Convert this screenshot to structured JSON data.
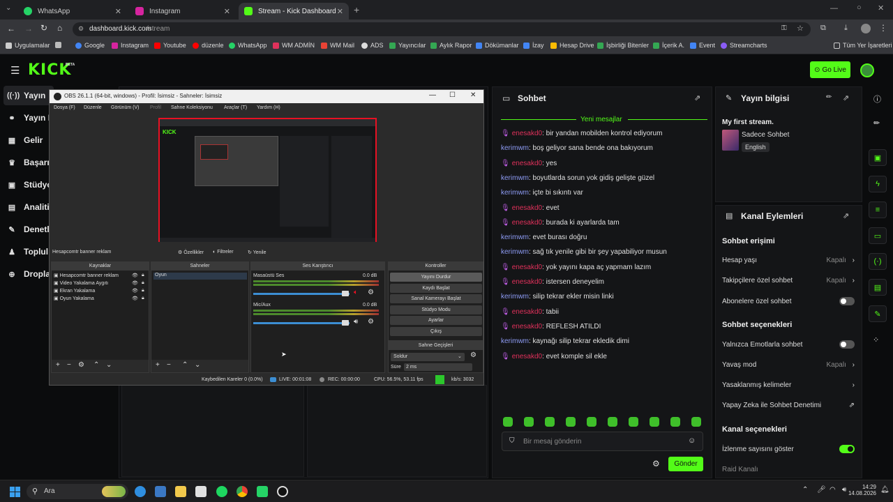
{
  "browser": {
    "tabs": [
      {
        "title": "WhatsApp",
        "color": "#25d366"
      },
      {
        "title": "Instagram",
        "color": "#d6249f"
      },
      {
        "title": "Stream - Kick Dashboard",
        "color": "#53fc18"
      }
    ],
    "url_host": "dashboard.kick.com",
    "url_path": "/stream",
    "bookmarks": [
      "Uygulamalar",
      "Google",
      "Instagram",
      "Youtube",
      "düzenle",
      "WhatsApp",
      "WM ADMİN",
      "WM Mail",
      "ADS",
      "Yayıncılar",
      "Aylık Rapor",
      "Dökümanlar",
      "İzay",
      "Hesap Drive",
      "İşbirliği Bitenler",
      "İçerik A.",
      "Event",
      "Streamcharts"
    ],
    "all_bookmarks": "Tüm Yer İşaretleri"
  },
  "kick": {
    "logo": "KICK",
    "logo_sup": "BETA",
    "go_live": "Go Live",
    "sidebar": [
      "Yayın",
      "Yayın B",
      "Gelir",
      "Başarı",
      "Stüdyo",
      "Analiti",
      "Denetl",
      "Toplul",
      "Dropla"
    ],
    "chat": {
      "title": "Sohbet",
      "new_messages": "Yeni mesajlar",
      "messages": [
        {
          "user": "enesakd0",
          "text": ": bir yandan mobilden kontrol ediyorum",
          "mic": true
        },
        {
          "user": "kerimwm",
          "text": ": boş geliyor sana bende ona bakıyorum",
          "mic": false
        },
        {
          "user": "enesakd0",
          "text": ": yes",
          "mic": true
        },
        {
          "user": "kerimwm",
          "text": ": boyutlarda sorun yok gidiş gelişte güzel",
          "mic": false
        },
        {
          "user": "kerimwm",
          "text": ": içte bi sıkıntı var",
          "mic": false
        },
        {
          "user": "enesakd0",
          "text": ": evet",
          "mic": true
        },
        {
          "user": "enesakd0",
          "text": ": burada ki ayarlarda tam",
          "mic": true
        },
        {
          "user": "kerimwm",
          "text": ": evet burası doğru",
          "mic": false
        },
        {
          "user": "kerimwm",
          "text": ": sağ tık yenile gibi bir şey yapabiliyor musun",
          "mic": false
        },
        {
          "user": "enesakd0",
          "text": ": yok yayını kapa aç yapmam lazım",
          "mic": true
        },
        {
          "user": "enesakd0",
          "text": ": istersen deneyelim",
          "mic": true
        },
        {
          "user": "kerimwm",
          "text": ": silip tekrar ekler misin linki",
          "mic": false
        },
        {
          "user": "enesakd0",
          "text": ": tabii",
          "mic": true
        },
        {
          "user": "enesakd0",
          "text": ": REFLESH ATILDI",
          "mic": true
        },
        {
          "user": "kerimwm",
          "text": ": kaynağı silip tekrar ekledik dimi",
          "mic": false
        },
        {
          "user": "enesakd0",
          "text": ": evet komple sil ekle",
          "mic": true
        }
      ],
      "input_placeholder": "Bir mesaj gönderin",
      "send": "Gönder"
    },
    "stream_info": {
      "title": "Yayın bilgisi",
      "stream_name": "My first stream.",
      "category": "Sadece Sohbet",
      "language": "English"
    },
    "channel_actions": {
      "title": "Kanal Eylemleri",
      "chat_access": "Sohbet erişimi",
      "account_age": "Hesap yaşı",
      "account_age_value": "Kapalı",
      "followers_only": "Takipçilere özel sohbet",
      "followers_only_value": "Kapalı",
      "subscribers_only": "Abonelere özel sohbet",
      "chat_options": "Sohbet seçenekleri",
      "emotes_only": "Yalnızca Emotlarla sohbet",
      "slow_mode": "Yavaş mod",
      "slow_mode_value": "Kapalı",
      "banned_words": "Yasaklanmış kelimeler",
      "ai_moderation": "Yapay Zeka ile Sohbet Denetimi",
      "channel_options": "Kanal seçenekleri",
      "show_viewers": "İzlenme sayısını göster",
      "raid": "Raid Kanalı"
    }
  },
  "obs": {
    "title": "OBS 26.1.1 (64-bit, windows) - Profil: İsimsiz - Sahneler: İsimsiz",
    "menu": [
      "Dosya (F)",
      "Düzenle",
      "Görünüm (V)",
      "Profil",
      "Sahne Koleksiyonu",
      "Araçlar (T)",
      "Yardım (H)"
    ],
    "source_label": "Hesapcomtr banner reklam",
    "props": "Özellikler",
    "filters": "Filtreler",
    "refresh": "Yenile",
    "docks": {
      "sources": "Kaynaklar",
      "scenes": "Sahneler",
      "mixer": "Ses Karıştırıcı",
      "controls": "Kontroller",
      "transitions": "Sahne Geçişleri"
    },
    "sources": [
      "Hesapcomtr banner reklam",
      "Video Yakalama Aygıtı",
      "Ekran Yakalama",
      "Oyun Yakalama"
    ],
    "scenes": [
      "Oyun"
    ],
    "mixer": [
      {
        "name": "Masaüstü Ses",
        "db": "0.0 dB"
      },
      {
        "name": "Mic/Aux",
        "db": "0.0 dB"
      }
    ],
    "controls": [
      "Yayını Durdur",
      "Kaydı Başlat",
      "Sanal Kamerayı Başlat",
      "Stüdyo Modu",
      "Ayarlar",
      "Çıkış"
    ],
    "transition": "Soldur",
    "duration_label": "Süre",
    "duration": "2 ms",
    "status": {
      "dropped": "Kaybedilen Kareler 0 (0.0%)",
      "live": "LIVE: 00:01:08",
      "rec": "REC: 00:00:00",
      "cpu": "CPU: 56.5%, 53.11 fps",
      "kbps": "kb/s: 3032"
    }
  },
  "taskbar": {
    "search": "Ara",
    "time": "14:29",
    "date": "14.08.2026"
  }
}
